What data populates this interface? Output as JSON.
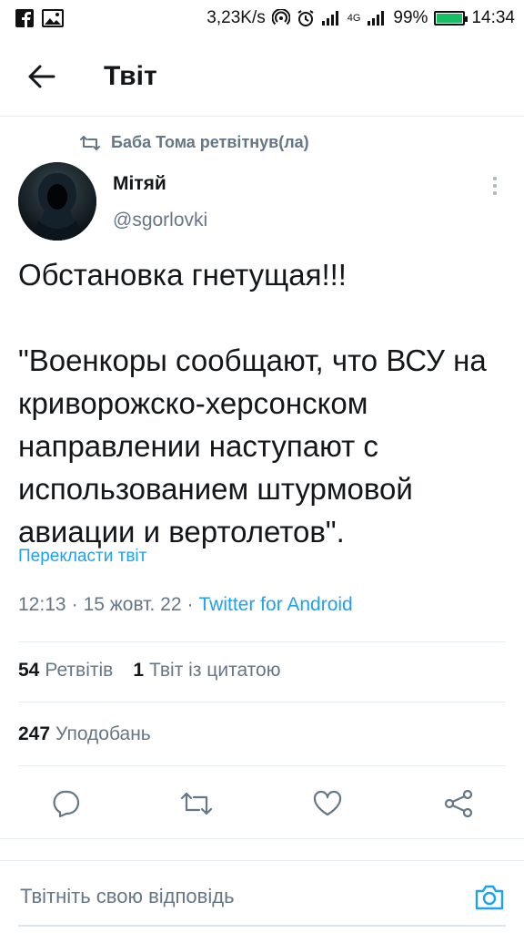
{
  "status_bar": {
    "speed": "3,23K/s",
    "network": "4G",
    "battery_percent": "99%",
    "battery_level": 0.99,
    "time": "14:34",
    "icons": [
      "facebook-icon",
      "gallery-icon",
      "hotspot-icon",
      "alarm-icon",
      "signal-icon",
      "signal-icon",
      "battery-icon"
    ]
  },
  "header": {
    "title": "Твіт",
    "back_icon": "arrow-left-icon"
  },
  "tweet": {
    "retweet_context": "Баба Тома ретвітнув(ла)",
    "author_name": "Мітяй",
    "author_handle": "@sgorlovki",
    "text": "Обстановка гнетущая!!!\n\n\"Военкоры сообщают, что ВСУ на криворожско-херсонском направлении наступают с использованием штурмовой авиации и вертолетов\".",
    "translate": "Перекласти твіт",
    "time": "12:13",
    "sep1": "·",
    "date": "15 жовт. 22",
    "sep2": "·",
    "source": "Twitter for Android"
  },
  "stats": {
    "retweets_count": "54",
    "retweets_label": "Ретвітів",
    "quotes_count": "1",
    "quotes_label": "Твіт із цитатою",
    "likes_count": "247",
    "likes_label": "Уподобань"
  },
  "actions": [
    "reply-icon",
    "retweet-icon",
    "like-icon",
    "share-icon"
  ],
  "reply": {
    "placeholder": "Твітніть свою відповідь"
  },
  "colors": {
    "accent": "#1da1f2",
    "text": "#14171a",
    "secondary": "#657786",
    "border": "#e6ecf0",
    "battery": "#17bf63"
  }
}
